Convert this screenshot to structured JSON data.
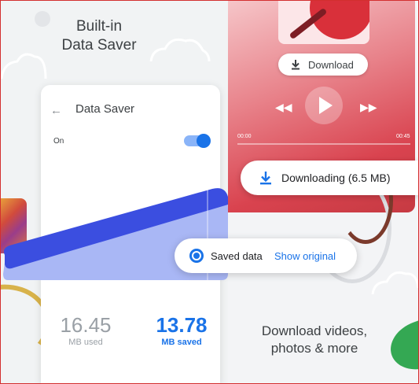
{
  "left": {
    "heading": "Built-in\nData Saver"
  },
  "phone": {
    "title": "Data Saver",
    "toggle_label": "On",
    "toggle_on": true,
    "used_value": "16.45",
    "used_label": "MB used",
    "saved_value": "13.78",
    "saved_label": "MB saved"
  },
  "video": {
    "download_chip_label": "Download",
    "time_current": "00:00",
    "time_total": "00:45",
    "progress_fraction": 0.0
  },
  "downloading": {
    "label": "Downloading (6.5 MB)"
  },
  "saved_pill": {
    "text": "Saved data",
    "link": "Show original"
  },
  "right": {
    "caption": "Download videos,\nphotos & more"
  },
  "colors": {
    "accent_blue": "#1a73e8",
    "wedge_blue": "#3b4ee0",
    "wedge_light": "#a9b7f5",
    "video_red": "#d9434f",
    "green": "#34a853"
  },
  "icons": [
    "back-arrow-icon",
    "download-icon",
    "rewind-icon",
    "play-icon",
    "fast-forward-icon",
    "chrome-icon"
  ]
}
